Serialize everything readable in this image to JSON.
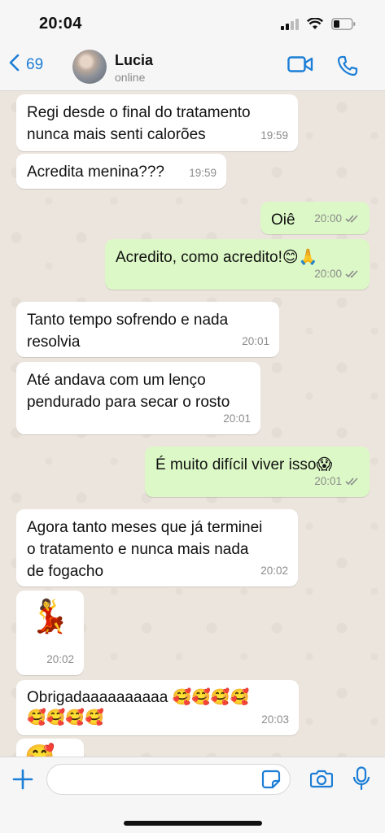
{
  "status_bar": {
    "time": "20:04"
  },
  "header": {
    "back_count": "69",
    "contact_name": "Lucia",
    "contact_status": "online"
  },
  "messages": [
    {
      "direction": "in",
      "text": "Regi desde o final do tratamento\nnunca mais senti calorões",
      "time": "19:59"
    },
    {
      "direction": "in",
      "text": "Acredita menina???",
      "time": "19:59"
    },
    {
      "direction": "out",
      "text": "Oiê",
      "time": "20:00",
      "status": "read"
    },
    {
      "direction": "out",
      "text": "Acredito, como acredito!😊🙏",
      "time": "20:00",
      "status": "read"
    },
    {
      "direction": "in",
      "text": "Tanto tempo sofrendo e nada\nresolvia",
      "time": "20:01"
    },
    {
      "direction": "in",
      "text": "Até andava com um lenço\npendurado para secar o rosto",
      "time": "20:01"
    },
    {
      "direction": "out",
      "text": "É muito difícil viver isso😱",
      "time": "20:01",
      "status": "read"
    },
    {
      "direction": "in",
      "text": "Agora tanto meses que já terminei\no tratamento e nunca mais nada\nde fogacho",
      "time": "20:02"
    },
    {
      "direction": "in",
      "text": "💃",
      "time": "20:02"
    },
    {
      "direction": "in",
      "text": "Obrigadaaaaaaaaaa 🥰🥰🥰🥰\n🥰🥰🥰🥰",
      "time": "20:03"
    },
    {
      "direction": "in",
      "text": "🥰",
      "time": ""
    }
  ],
  "input": {
    "placeholder": ""
  },
  "colors": {
    "accent": "#1c7ed6",
    "incoming": "#ffffff",
    "outgoing": "#dcf8c6",
    "background": "#ece5dd"
  }
}
